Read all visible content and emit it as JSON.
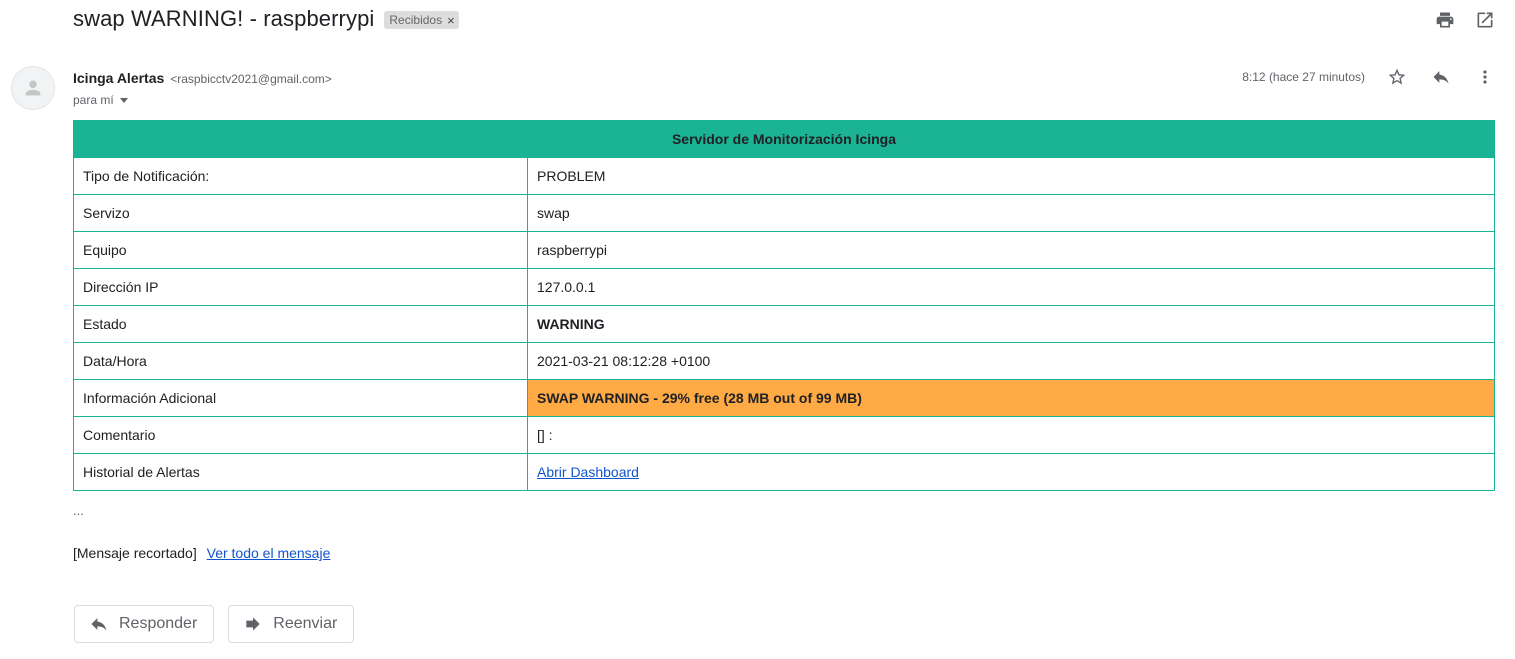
{
  "subject": "swap WARNING! - raspberrypi",
  "label_chip": {
    "text": "Recibidos",
    "remove": "×"
  },
  "sender": {
    "name": "Icinga Alertas",
    "email": "<raspbicctv2021@gmail.com>",
    "to": "para mí",
    "time": "8:12 (hace 27 minutos)"
  },
  "table": {
    "header": "Servidor de Monitorización Icinga",
    "rows": [
      {
        "key": "Tipo de Notificación:",
        "value": "PROBLEM"
      },
      {
        "key": "Servizo",
        "value": "swap"
      },
      {
        "key": "Equipo",
        "value": "raspberrypi"
      },
      {
        "key": "Dirección IP",
        "value": "127.0.0.1"
      },
      {
        "key": "Estado",
        "value": "WARNING"
      },
      {
        "key": "Data/Hora",
        "value": "2021-03-21 08:12:28 +0100"
      },
      {
        "key": "Información Adicional",
        "value": "SWAP WARNING - 29% free (28 MB out of 99 MB)"
      },
      {
        "key": "Comentario",
        "value": "[] :"
      },
      {
        "key": "Historial de Alertas",
        "value": "Abrir Dashboard"
      }
    ]
  },
  "ellipsis": "...",
  "clipped": {
    "text": "[Mensaje recortado]",
    "link": "Ver todo el mensaje"
  },
  "actions": {
    "reply": "Responder",
    "forward": "Reenviar"
  },
  "colors": {
    "header": "#1ab394",
    "warning": "#ffaa44",
    "link": "#1155cc"
  },
  "icons": [
    "print-icon",
    "open-in-new-icon",
    "star-icon",
    "reply-icon",
    "more-vert-icon",
    "person-icon",
    "forward-icon"
  ]
}
